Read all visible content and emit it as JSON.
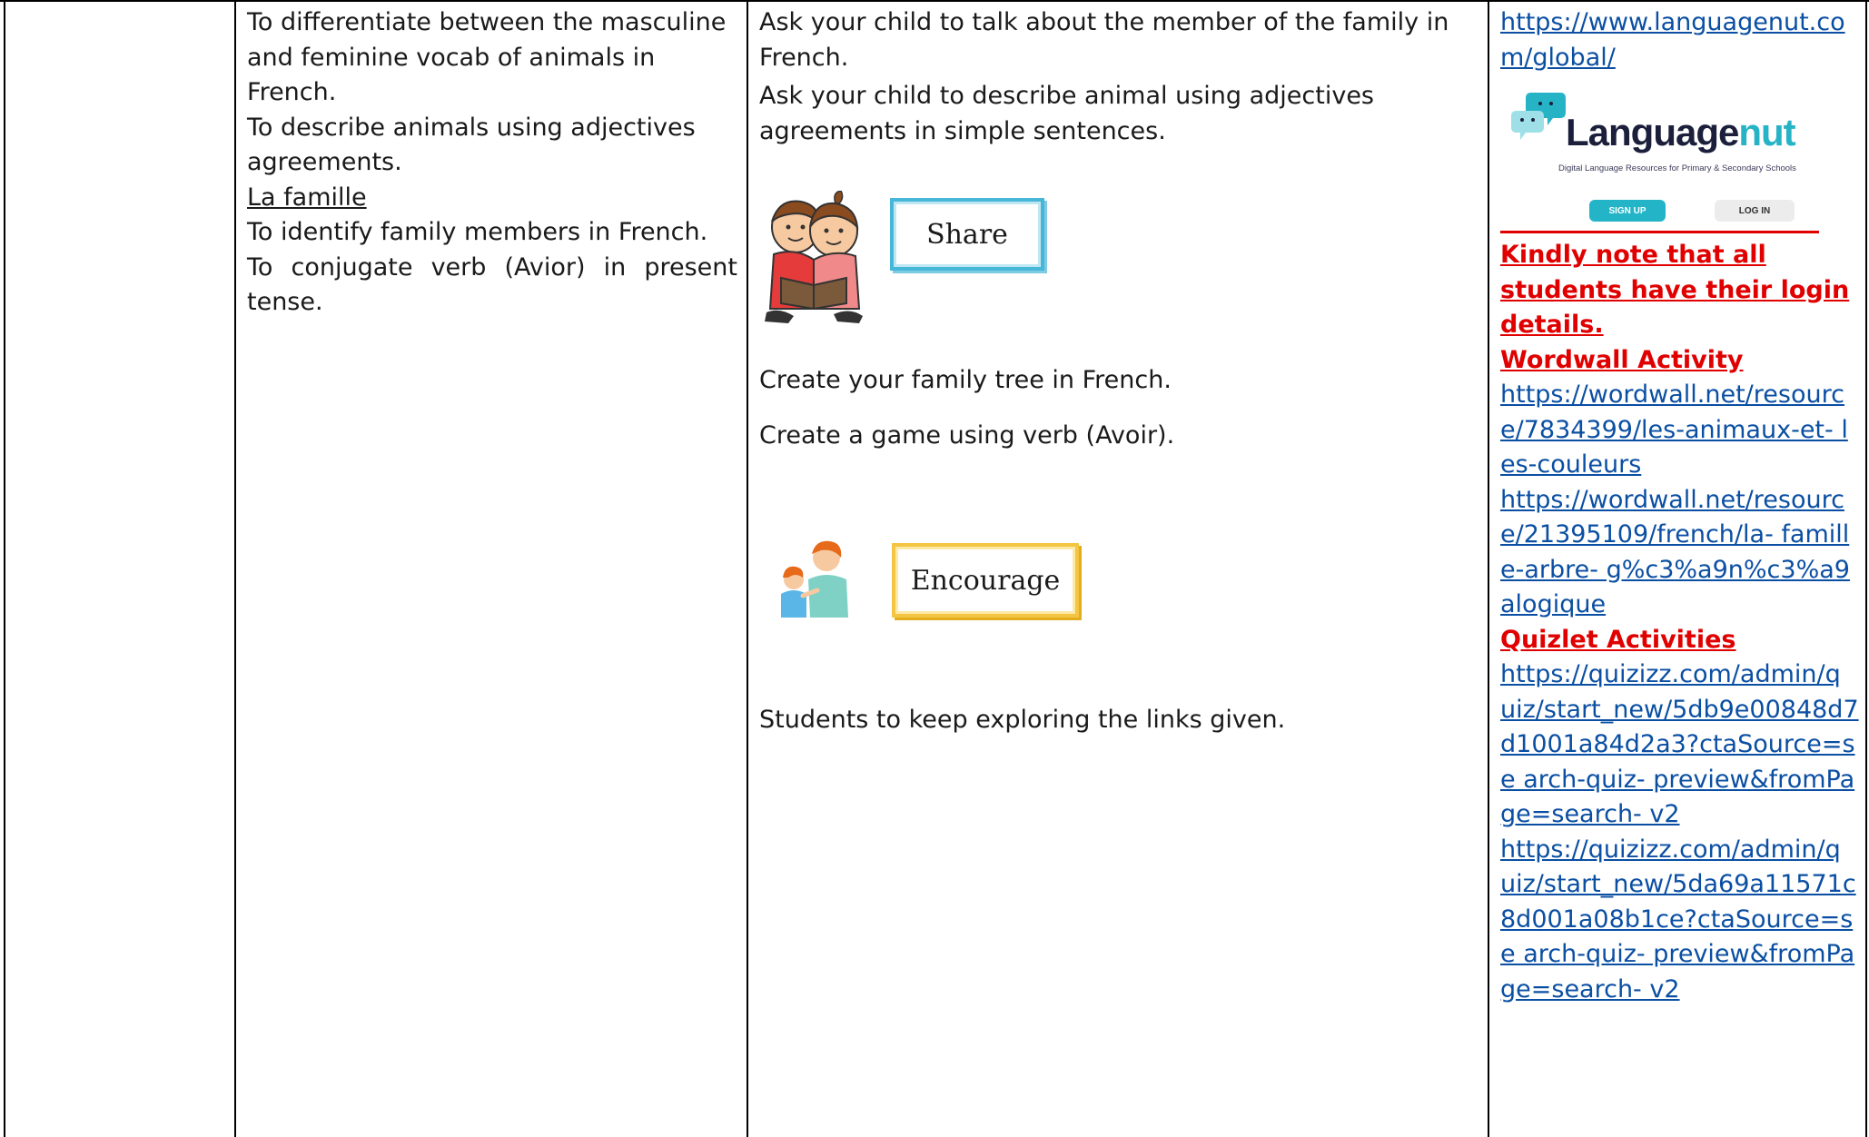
{
  "col2": {
    "line1": "To differentiate between the masculine",
    "line2": "and feminine vocab of animals in French.",
    "line3": "To describe animals using adjectives",
    "line4": "agreements.",
    "heading": "La famille",
    "line5": "To identify family members in French.",
    "line6": "To conjugate verb (Avior) in present",
    "line7": "tense."
  },
  "col3": {
    "para1_a": "Ask your child to talk about the member of the family in",
    "para1_b": "French.",
    "para2_a": "Ask your child to describe animal using adjectives",
    "para2_b": "agreements in simple sentences.",
    "share_label": "Share",
    "task1": "Create your family tree in French.",
    "task2": "Create a game using verb (Avoir).",
    "encourage_label": "Encourage",
    "task3": "Students to keep exploring the links given."
  },
  "col4": {
    "link1": "https://www.languagenut.co m/global/",
    "logo_main": "Language",
    "logo_accent": "nut",
    "logo_subtitle": "Digital Language Resources for Primary & Secondary Schools",
    "signup_label": "SIGN UP",
    "login_label": "LOG IN",
    "note": "Kindly note that all students have their login details.",
    "wordwall_heading": "Wordwall Activity",
    "wordwall_link1": "https://wordwall.net/resourc e/7834399/les-animaux-et- les-couleurs",
    "wordwall_link2": "https://wordwall.net/resourc e/21395109/french/la- famille-arbre- g%c3%a9n%c3%a9alogique",
    "quizlet_heading": "Quizlet Activities",
    "quizlet_link1": "https://quizizz.com/admin/q uiz/start_new/5db9e00848d7 d1001a84d2a3?ctaSource=se arch-quiz- preview&fromPage=search- v2",
    "quizlet_link2": "https://quizizz.com/admin/q uiz/start_new/5da69a11571c 8d001a08b1ce?ctaSource=se arch-quiz- preview&fromPage=search- v2"
  }
}
